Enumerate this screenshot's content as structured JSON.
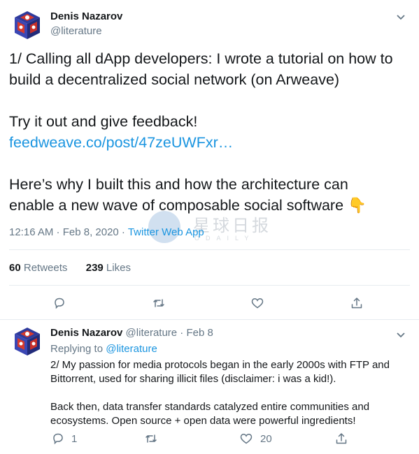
{
  "main_tweet": {
    "author_name": "Denis Nazarov",
    "author_handle": "@literature",
    "lines": {
      "l1": "1/ Calling all dApp developers: I wrote a tutorial on how to",
      "l2": "build a decentralized social network (on Arweave)",
      "l3": "Try it out and give feedback!",
      "link": "feedweave.co/post/47zeUWFxr…",
      "l5": "Here’s why I built this and how the architecture can",
      "l6": "enable a new wave of composable social software",
      "emoji": "👇"
    },
    "timestamp": "12:16 AM · Feb 8, 2020 · ",
    "source": "Twitter Web App",
    "stats": {
      "retweets_count": "60",
      "retweets_label": " Retweets",
      "likes_count": "239",
      "likes_label": " Likes"
    }
  },
  "reply_tweet": {
    "author_name": "Denis Nazarov",
    "author_handle": "@literature",
    "date": " · Feb 8",
    "replying_prefix": "Replying to ",
    "replying_handle": "@literature",
    "lines": {
      "l1": "2/ My passion for media protocols began in the early 2000s with FTP and",
      "l2": "Bittorrent, used for sharing illicit files (disclaimer: i was a kid!).",
      "l3": "Back then, data transfer standards catalyzed entire communities and",
      "l4": "ecosystems. Open source + open data were powerful ingredients!"
    },
    "reply_count": "1",
    "like_count": "20"
  },
  "watermark": {
    "text": "星球日报",
    "sub": "ODAILY"
  },
  "colors": {
    "link": "#1b95e0",
    "secondary_text": "#657786",
    "divider": "#e6ecf0",
    "avatar_primary": "#d63a2e",
    "avatar_secondary": "#2f3a9c"
  },
  "icons": [
    "avatar-cube-icon",
    "chevron-down-icon",
    "reply-icon",
    "retweet-icon",
    "like-icon",
    "share-icon"
  ]
}
